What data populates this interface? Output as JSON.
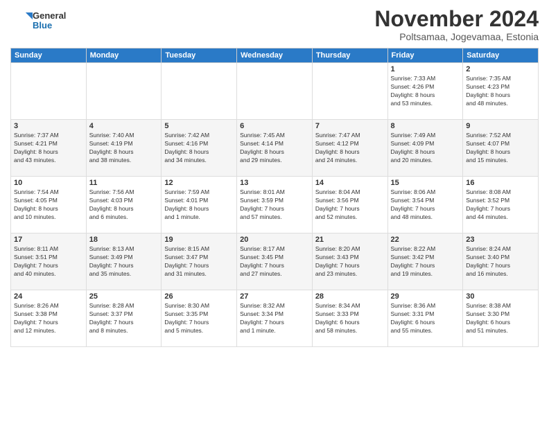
{
  "logo": {
    "general": "General",
    "blue": "Blue"
  },
  "header": {
    "month": "November 2024",
    "location": "Poltsamaa, Jogevamaa, Estonia"
  },
  "weekdays": [
    "Sunday",
    "Monday",
    "Tuesday",
    "Wednesday",
    "Thursday",
    "Friday",
    "Saturday"
  ],
  "weeks": [
    [
      {
        "day": "",
        "info": ""
      },
      {
        "day": "",
        "info": ""
      },
      {
        "day": "",
        "info": ""
      },
      {
        "day": "",
        "info": ""
      },
      {
        "day": "",
        "info": ""
      },
      {
        "day": "1",
        "info": "Sunrise: 7:33 AM\nSunset: 4:26 PM\nDaylight: 8 hours\nand 53 minutes."
      },
      {
        "day": "2",
        "info": "Sunrise: 7:35 AM\nSunset: 4:23 PM\nDaylight: 8 hours\nand 48 minutes."
      }
    ],
    [
      {
        "day": "3",
        "info": "Sunrise: 7:37 AM\nSunset: 4:21 PM\nDaylight: 8 hours\nand 43 minutes."
      },
      {
        "day": "4",
        "info": "Sunrise: 7:40 AM\nSunset: 4:19 PM\nDaylight: 8 hours\nand 38 minutes."
      },
      {
        "day": "5",
        "info": "Sunrise: 7:42 AM\nSunset: 4:16 PM\nDaylight: 8 hours\nand 34 minutes."
      },
      {
        "day": "6",
        "info": "Sunrise: 7:45 AM\nSunset: 4:14 PM\nDaylight: 8 hours\nand 29 minutes."
      },
      {
        "day": "7",
        "info": "Sunrise: 7:47 AM\nSunset: 4:12 PM\nDaylight: 8 hours\nand 24 minutes."
      },
      {
        "day": "8",
        "info": "Sunrise: 7:49 AM\nSunset: 4:09 PM\nDaylight: 8 hours\nand 20 minutes."
      },
      {
        "day": "9",
        "info": "Sunrise: 7:52 AM\nSunset: 4:07 PM\nDaylight: 8 hours\nand 15 minutes."
      }
    ],
    [
      {
        "day": "10",
        "info": "Sunrise: 7:54 AM\nSunset: 4:05 PM\nDaylight: 8 hours\nand 10 minutes."
      },
      {
        "day": "11",
        "info": "Sunrise: 7:56 AM\nSunset: 4:03 PM\nDaylight: 8 hours\nand 6 minutes."
      },
      {
        "day": "12",
        "info": "Sunrise: 7:59 AM\nSunset: 4:01 PM\nDaylight: 8 hours\nand 1 minute."
      },
      {
        "day": "13",
        "info": "Sunrise: 8:01 AM\nSunset: 3:59 PM\nDaylight: 7 hours\nand 57 minutes."
      },
      {
        "day": "14",
        "info": "Sunrise: 8:04 AM\nSunset: 3:56 PM\nDaylight: 7 hours\nand 52 minutes."
      },
      {
        "day": "15",
        "info": "Sunrise: 8:06 AM\nSunset: 3:54 PM\nDaylight: 7 hours\nand 48 minutes."
      },
      {
        "day": "16",
        "info": "Sunrise: 8:08 AM\nSunset: 3:52 PM\nDaylight: 7 hours\nand 44 minutes."
      }
    ],
    [
      {
        "day": "17",
        "info": "Sunrise: 8:11 AM\nSunset: 3:51 PM\nDaylight: 7 hours\nand 40 minutes."
      },
      {
        "day": "18",
        "info": "Sunrise: 8:13 AM\nSunset: 3:49 PM\nDaylight: 7 hours\nand 35 minutes."
      },
      {
        "day": "19",
        "info": "Sunrise: 8:15 AM\nSunset: 3:47 PM\nDaylight: 7 hours\nand 31 minutes."
      },
      {
        "day": "20",
        "info": "Sunrise: 8:17 AM\nSunset: 3:45 PM\nDaylight: 7 hours\nand 27 minutes."
      },
      {
        "day": "21",
        "info": "Sunrise: 8:20 AM\nSunset: 3:43 PM\nDaylight: 7 hours\nand 23 minutes."
      },
      {
        "day": "22",
        "info": "Sunrise: 8:22 AM\nSunset: 3:42 PM\nDaylight: 7 hours\nand 19 minutes."
      },
      {
        "day": "23",
        "info": "Sunrise: 8:24 AM\nSunset: 3:40 PM\nDaylight: 7 hours\nand 16 minutes."
      }
    ],
    [
      {
        "day": "24",
        "info": "Sunrise: 8:26 AM\nSunset: 3:38 PM\nDaylight: 7 hours\nand 12 minutes."
      },
      {
        "day": "25",
        "info": "Sunrise: 8:28 AM\nSunset: 3:37 PM\nDaylight: 7 hours\nand 8 minutes."
      },
      {
        "day": "26",
        "info": "Sunrise: 8:30 AM\nSunset: 3:35 PM\nDaylight: 7 hours\nand 5 minutes."
      },
      {
        "day": "27",
        "info": "Sunrise: 8:32 AM\nSunset: 3:34 PM\nDaylight: 7 hours\nand 1 minute."
      },
      {
        "day": "28",
        "info": "Sunrise: 8:34 AM\nSunset: 3:33 PM\nDaylight: 6 hours\nand 58 minutes."
      },
      {
        "day": "29",
        "info": "Sunrise: 8:36 AM\nSunset: 3:31 PM\nDaylight: 6 hours\nand 55 minutes."
      },
      {
        "day": "30",
        "info": "Sunrise: 8:38 AM\nSunset: 3:30 PM\nDaylight: 6 hours\nand 51 minutes."
      }
    ]
  ]
}
